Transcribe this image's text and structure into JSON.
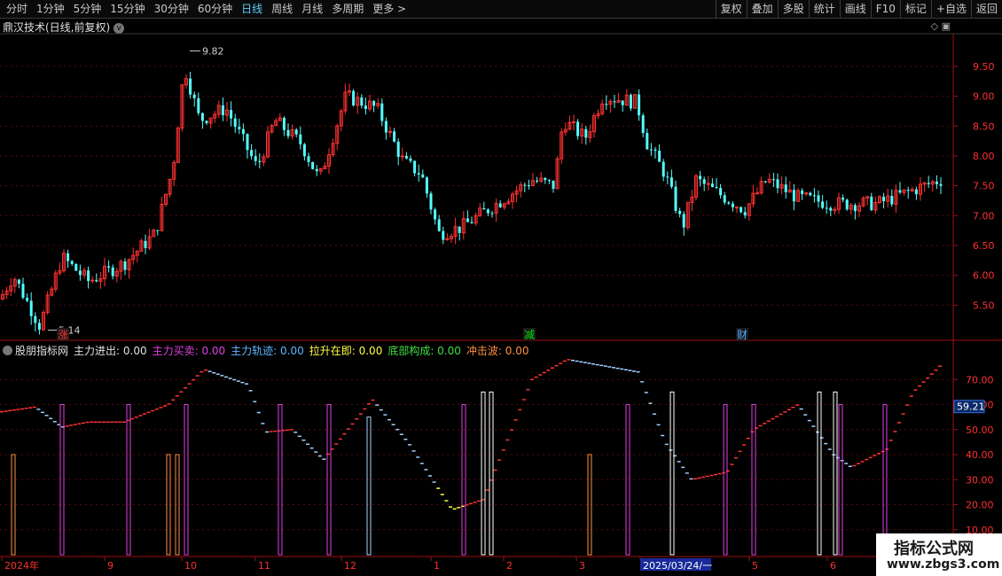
{
  "toolbar": {
    "periods": [
      "分时",
      "1分钟",
      "5分钟",
      "15分钟",
      "30分钟",
      "60分钟",
      "日线",
      "周线",
      "月线",
      "多周期",
      "更多 >"
    ],
    "active_period": "日线",
    "actions": [
      "复权",
      "叠加",
      "多股",
      "统计",
      "画线",
      "F10",
      "标记",
      "+自选",
      "返回"
    ]
  },
  "title": "鼎汉技术(日线,前复权)",
  "main_axis": {
    "labels": [
      "9.50",
      "9.00",
      "8.50",
      "8.00",
      "7.50",
      "7.00",
      "6.50",
      "6.00",
      "5.50"
    ],
    "min": 5.0,
    "max": 9.9
  },
  "annotations": {
    "high": "9.82",
    "low": "5.14"
  },
  "markers": [
    {
      "text": "涨",
      "color": "#ff3030"
    },
    {
      "text": "减",
      "color": "#00e000"
    },
    {
      "text": "财",
      "color": "#4fa8ff"
    }
  ],
  "indicator": {
    "name": "股朋指标网",
    "fields": [
      {
        "label": "主力进出: 0.00",
        "color": "#e0e0e0"
      },
      {
        "label": "主力买卖: 0.00",
        "color": "#e040e0"
      },
      {
        "label": "主力轨迹: 0.00",
        "color": "#5fb8ff"
      },
      {
        "label": "拉升在即: 0.00",
        "color": "#ffff40"
      },
      {
        "label": "底部构成: 0.00",
        "color": "#40e040"
      },
      {
        "label": "冲击波: 0.00",
        "color": "#ff9040"
      }
    ],
    "axis_labels": [
      "70.00",
      "60.00",
      "50.00",
      "40.00",
      "30.00",
      "20.00",
      "10.00"
    ],
    "current_value": "59.21",
    "current_value_num": 59.21
  },
  "date_axis": {
    "labels": [
      "2024年",
      "9",
      "10",
      "11",
      "12",
      "1",
      "2",
      "3",
      "2025/03/24/一",
      "5",
      "6"
    ],
    "highlight": "2025/03/24/一"
  },
  "watermark": {
    "line1": "指标公式网",
    "line2": "www.zbgs3.com"
  }
}
